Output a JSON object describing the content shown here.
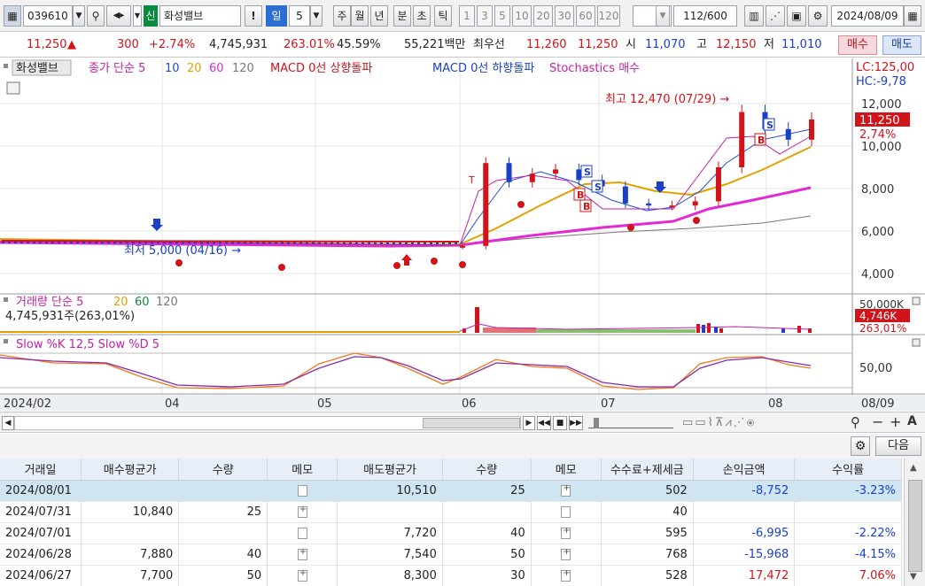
{
  "toolbar": {
    "code": "039610",
    "name": "화성밸브",
    "badge": "신",
    "exclaim": "!",
    "period": "일",
    "period_n": "5",
    "periods": [
      "주",
      "월",
      "년",
      "분",
      "초",
      "틱"
    ],
    "mins": [
      "1",
      "3",
      "5",
      "10",
      "20",
      "30",
      "60",
      "120"
    ],
    "count": "112",
    "count_max": "/600",
    "date": "2024/08/09"
  },
  "quote": {
    "price": "11,250",
    "arrow": "▲",
    "change": "300",
    "change_pct": "+2.74%",
    "volume": "4,745,931",
    "vol_ratio": "263.01%",
    "turnover": "45.59%",
    "amount": "55,221백만",
    "best_label": "최우선",
    "best_ask": "11,260",
    "best_bid": "11,250",
    "open_label": "시",
    "open": "11,070",
    "high_label": "고",
    "high": "12,150",
    "low_label": "저",
    "low": "11,010",
    "buy": "매수",
    "sell": "매도"
  },
  "legend": {
    "name": "화성밸브",
    "close": "종가 단순 5",
    "ma10": "10",
    "ma20": "20",
    "ma60": "60",
    "ma120": "120",
    "macd_up": "MACD 0선 상향돌파",
    "macd_down": "MACD 0선 하향돌파",
    "stoch": "Stochastics 매수"
  },
  "scale": {
    "lc": "LC:125,00",
    "hc": "HC:-9,78",
    "ticks": [
      "12,000",
      "10,000",
      "8,000",
      "6,000",
      "4,000"
    ],
    "last": "11,250",
    "last_pct": "2,74%"
  },
  "annot": {
    "high": "최고 12,470 (07/29) →",
    "low": "최저 5,000 (04/16) →"
  },
  "vol": {
    "legend": "거래량 단순 5",
    "v20": "20",
    "v60": "60",
    "v120": "120",
    "value": "4,745,931주(263,01%)",
    "top": "50,000K",
    "last": "4,746K",
    "last_pct": "263,01%"
  },
  "stoch": {
    "legend": "Slow %K 12,5 Slow %D 5",
    "tick": "50,00"
  },
  "xaxis": {
    "labels": [
      "2024/02",
      "04",
      "05",
      "06",
      "07",
      "08"
    ],
    "end": "08/09"
  },
  "chart_data": {
    "type": "candlestick",
    "dates": [
      "06/03",
      "06/07",
      "06/12",
      "06/17",
      "06/21",
      "06/26",
      "07/01",
      "07/05",
      "07/10",
      "07/15",
      "07/19",
      "07/24",
      "07/29",
      "08/02",
      "08/07",
      "08/09"
    ],
    "close": [
      5300,
      9200,
      8300,
      8700,
      8900,
      8400,
      8100,
      7300,
      7200,
      7200,
      7400,
      9000,
      11600,
      10800,
      10300,
      11250
    ],
    "ma20": [
      5200,
      5900,
      6500,
      7000,
      7500,
      7800,
      8000,
      8100,
      8000,
      7800,
      7800,
      8000,
      8600,
      9300,
      9600,
      9950
    ],
    "ma60": [
      5300,
      5400,
      5500,
      5650,
      5800,
      5900,
      6050,
      6200,
      6300,
      6450,
      6600,
      6750,
      7000,
      7300,
      7700,
      8100
    ],
    "price_range": [
      3500,
      12800
    ]
  },
  "gridtb": {
    "next": "다음"
  },
  "table": {
    "headers": [
      "거래일",
      "매수평균가",
      "수량",
      "메모",
      "매도평균가",
      "수량",
      "메모",
      "수수료+제세금",
      "손익금액",
      "수익률"
    ],
    "rows": [
      [
        "2024/08/01",
        "",
        "",
        "",
        "10,510",
        "25",
        "",
        "502",
        "-8,752",
        "-3.23%"
      ],
      [
        "2024/07/31",
        "10,840",
        "25",
        "",
        "",
        "",
        "",
        "40",
        "",
        ""
      ],
      [
        "2024/07/01",
        "",
        "",
        "",
        "7,720",
        "40",
        "",
        "595",
        "-6,995",
        "-2.22%"
      ],
      [
        "2024/06/28",
        "7,880",
        "40",
        "",
        "7,540",
        "50",
        "",
        "768",
        "-15,968",
        "-4.15%"
      ],
      [
        "2024/06/27",
        "7,700",
        "50",
        "",
        "8,300",
        "30",
        "",
        "528",
        "17,472",
        "7.06%"
      ]
    ]
  }
}
